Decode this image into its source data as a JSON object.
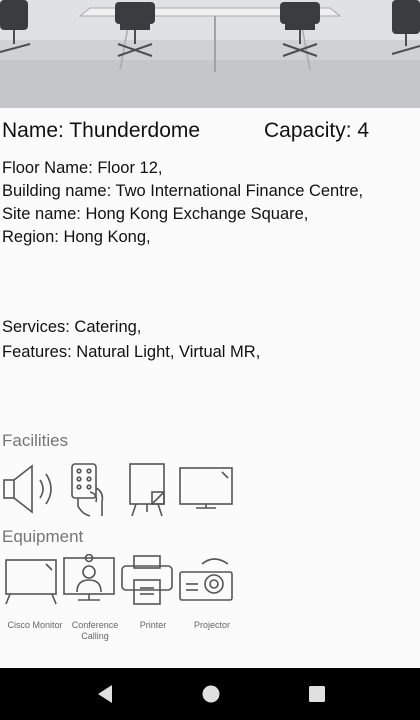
{
  "room": {
    "name_line": "Name: Thunderdome",
    "capacity_line": "Capacity: 4"
  },
  "location": {
    "floor": "Floor Name: Floor 12,",
    "building": "Building name: Two International Finance Centre,",
    "site": "Site name: Hong Kong Exchange Square,",
    "region": "Region: Hong Kong,"
  },
  "amenities": {
    "services": "Services: Catering,",
    "features": "Features: Natural Light, Virtual MR,"
  },
  "facilities": {
    "title": "Facilities",
    "icons": [
      "speaker-icon",
      "remote-control-icon",
      "flipchart-icon",
      "tv-screen-icon"
    ]
  },
  "equipment": {
    "title": "Equipment",
    "items": [
      {
        "label": "Cisco Monitor",
        "icon": "monitor-icon"
      },
      {
        "label": "Conference Calling",
        "icon": "video-call-icon"
      },
      {
        "label": "Printer",
        "icon": "printer-icon"
      },
      {
        "label": "Projector",
        "icon": "projector-icon"
      }
    ]
  },
  "navigation": {
    "buttons": [
      "back-icon",
      "home-icon",
      "recents-icon"
    ]
  },
  "colors": {
    "section_title": "#757575",
    "nav_background": "#000000"
  }
}
